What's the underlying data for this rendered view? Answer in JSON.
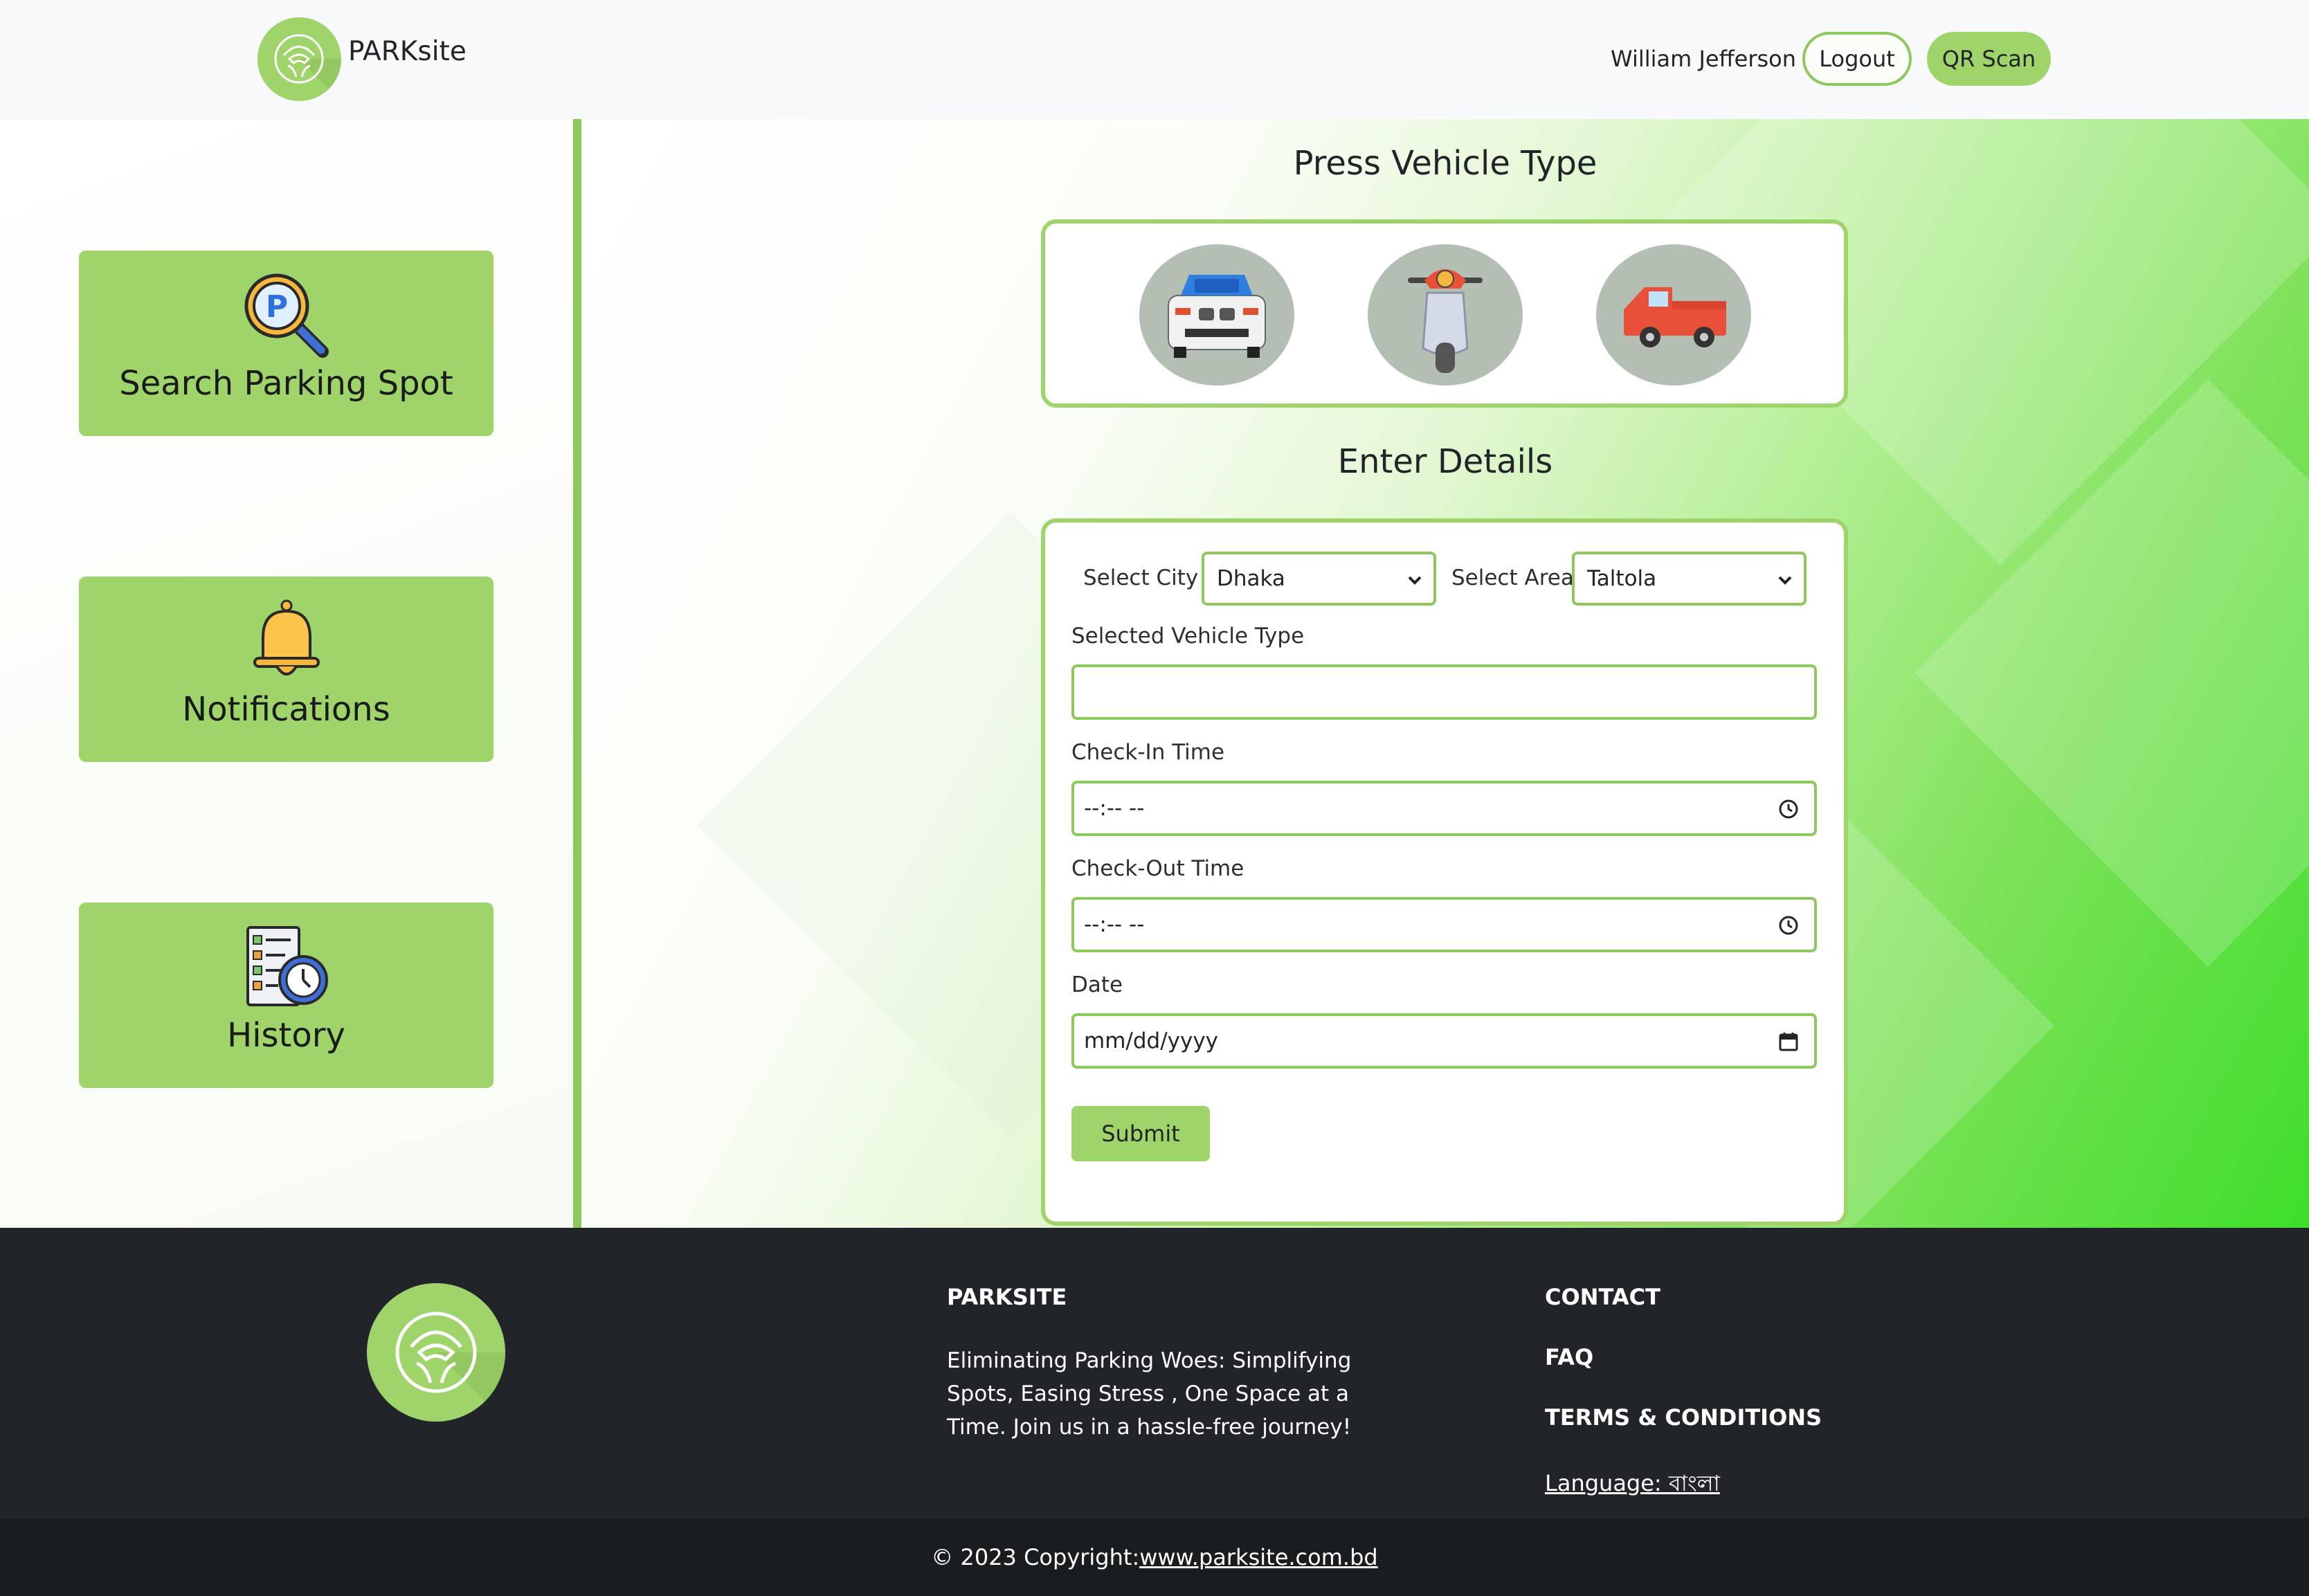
{
  "header": {
    "brand": "PARKsite",
    "user_name": "William Jefferson",
    "logout_label": "Logout",
    "qr_label": "QR Scan"
  },
  "sidebar": {
    "items": [
      {
        "label": "Search Parking Spot",
        "icon": "parking-search-icon"
      },
      {
        "label": "Notifications",
        "icon": "bell-icon"
      },
      {
        "label": "History",
        "icon": "history-checklist-clock-icon"
      }
    ]
  },
  "main": {
    "vehicle_title": "Press Vehicle Type",
    "vehicles": [
      {
        "icon": "car-icon"
      },
      {
        "icon": "scooter-icon"
      },
      {
        "icon": "pickup-truck-icon"
      }
    ],
    "details_title": "Enter Details",
    "form": {
      "city_label": "Select City",
      "city_value": "Dhaka",
      "area_label": "Select Area",
      "area_value": "Taltola",
      "vehicle_type_label": "Selected Vehicle Type",
      "vehicle_type_value": "",
      "checkin_label": "Check-In Time",
      "checkin_value": "--:-- --",
      "checkout_label": "Check-Out Time",
      "checkout_value": "--:-- --",
      "date_label": "Date",
      "date_value": "mm/dd/yyyy",
      "submit_label": "Submit"
    }
  },
  "footer": {
    "about_heading": "PARKSITE",
    "about_text": "Eliminating Parking Woes: Simplifying Spots, Easing Stress , One Space at a Time. Join us in a hassle-free journey!",
    "contact": "CONTACT",
    "faq": "FAQ",
    "terms": "TERMS & CONDITIONS",
    "language": "Language: বাংলা",
    "copyright_prefix": "© 2023 Copyright:",
    "copyright_link": "www.parksite.com.bd"
  },
  "colors": {
    "accent": "#9fd46a",
    "accent_border": "#8cc85a",
    "footer_bg": "#212529",
    "copyright_bg": "#1a1d20"
  }
}
